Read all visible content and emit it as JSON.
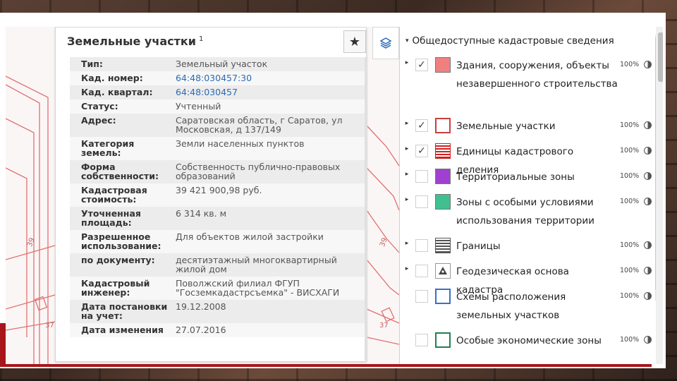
{
  "card": {
    "title": "Земельные участки",
    "title_sup": "1",
    "fav_icon": "star-icon",
    "rows": [
      {
        "k": "Тип:",
        "v": "Земельный участок",
        "link": false
      },
      {
        "k": "Кад. номер:",
        "v": "64:48:030457:30",
        "link": true
      },
      {
        "k": "Кад. квартал:",
        "v": "64:48:030457",
        "link": true
      },
      {
        "k": "Статус:",
        "v": "Учтенный",
        "link": false
      },
      {
        "k": "Адрес:",
        "v": "Саратовская область, г Саратов, ул Московская, д 137/149",
        "link": false
      },
      {
        "k": "Категория земель:",
        "v": "Земли населенных пунктов",
        "link": false
      },
      {
        "k": "Форма собственности:",
        "v": "Собственность публично-правовых образований",
        "link": false
      },
      {
        "k": "Кадастровая стоимость:",
        "v": "39 421 900,98 руб.",
        "link": false
      },
      {
        "k": "Уточненная площадь:",
        "v": "6 314 кв. м",
        "link": false
      },
      {
        "k": "Разрешенное использование:",
        "v": "Для объектов жилой застройки",
        "link": false
      },
      {
        "k": "по документу:",
        "v": "десятиэтажный многоквартирный жилой дом",
        "link": false
      },
      {
        "k": "Кадастровый инженер:",
        "v": "Поволжский филиал ФГУП \"Госземкадастрсъемка\" - ВИСХАГИ",
        "link": false
      },
      {
        "k": "Дата постановки на учет:",
        "v": "19.12.2008",
        "link": false
      },
      {
        "k": "Дата изменения",
        "v": "27.07.2016",
        "link": false
      }
    ]
  },
  "map": {
    "labels": [
      "39",
      "37",
      "39",
      "37"
    ]
  },
  "panel": {
    "title": "Общедоступные кадастровые сведения",
    "layers": [
      {
        "label": "Здания, сооружения, объекты незавершенного строительства",
        "checked": true,
        "pct": "100%",
        "swatch": "fill-red",
        "color": "#f08080",
        "expand": true
      },
      {
        "label": "Земельные участки",
        "checked": true,
        "pct": "100%",
        "swatch": "outline-red",
        "color": "#c84040",
        "expand": true
      },
      {
        "label": "Единицы кадастрового деления",
        "checked": true,
        "pct": "100%",
        "swatch": "lines-red",
        "color": "#d02020",
        "expand": true
      },
      {
        "label": "Территориальные зоны",
        "checked": false,
        "pct": "100%",
        "swatch": "fill-purple",
        "color": "#a040d0",
        "expand": true
      },
      {
        "label": "Зоны с особыми условиями использования территории",
        "checked": false,
        "pct": "100%",
        "swatch": "fill-green",
        "color": "#40c090",
        "expand": true
      },
      {
        "label": "Границы",
        "checked": false,
        "pct": "100%",
        "swatch": "lines-gray",
        "color": "#555555",
        "expand": true
      },
      {
        "label": "Геодезическая основа кадастра",
        "checked": false,
        "pct": "100%",
        "swatch": "triangle",
        "color": "#444444",
        "expand": true
      },
      {
        "label": "Схемы расположения земельных участков",
        "checked": false,
        "pct": "100%",
        "swatch": "outline-blue",
        "color": "#3a70c0",
        "expand": false
      },
      {
        "label": "Особые экономические зоны",
        "checked": false,
        "pct": "100%",
        "swatch": "outline-green",
        "color": "#208050",
        "expand": false
      }
    ]
  },
  "check_mark": "✓",
  "caret": "▸",
  "caret_down": "▾"
}
